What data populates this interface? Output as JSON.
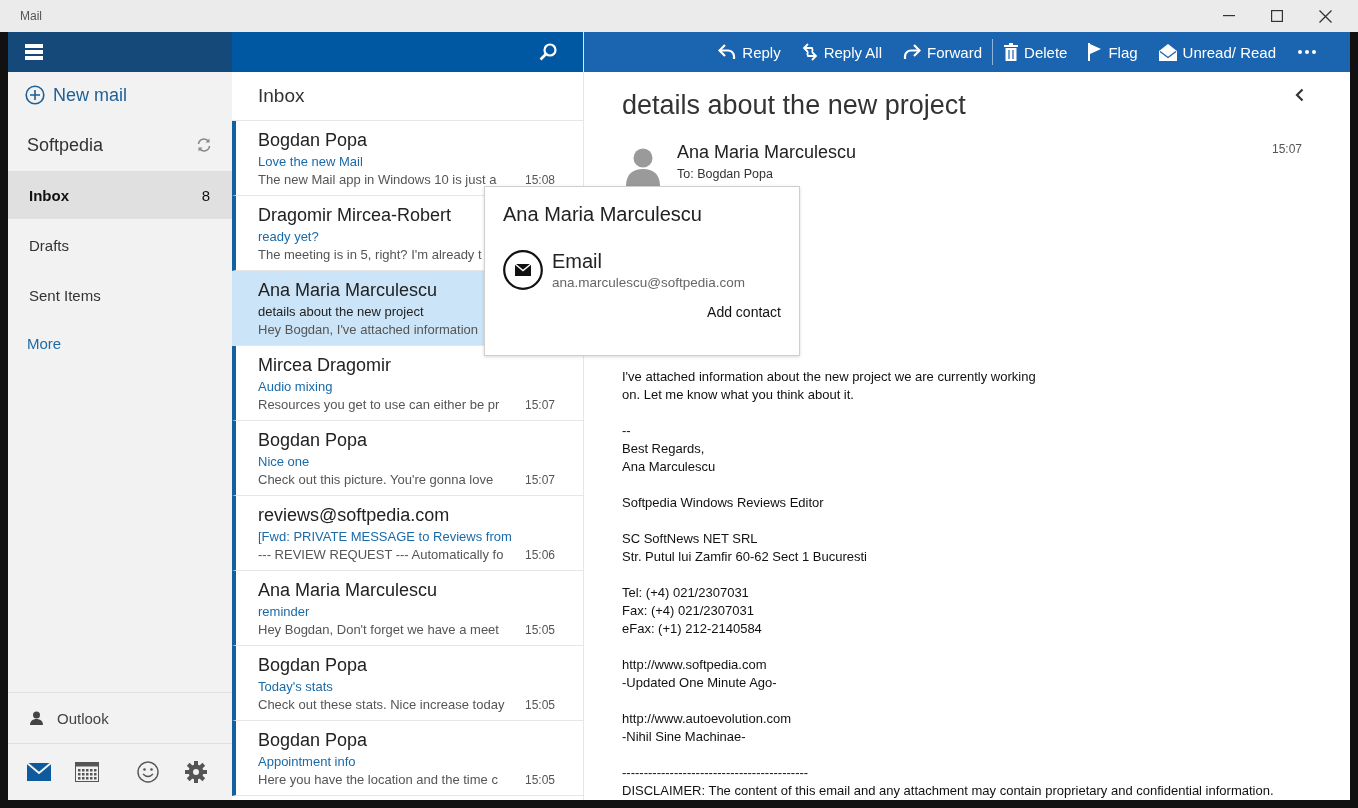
{
  "window": {
    "title": "Mail"
  },
  "sidebar": {
    "new_mail": "New mail",
    "account": "Softpedia",
    "folders": [
      {
        "label": "Inbox",
        "count": "8",
        "selected": true
      },
      {
        "label": "Drafts",
        "selected": false
      },
      {
        "label": "Sent Items",
        "selected": false
      }
    ],
    "more": "More",
    "account_switch": "Outlook"
  },
  "toolbar": {
    "actions": [
      {
        "kind": "reply",
        "label": "Reply"
      },
      {
        "kind": "reply-all",
        "label": "Reply All"
      },
      {
        "kind": "forward",
        "label": "Forward"
      },
      {
        "kind": "delete",
        "label": "Delete"
      },
      {
        "kind": "flag",
        "label": "Flag"
      },
      {
        "kind": "unread",
        "label": "Unread/ Read"
      }
    ]
  },
  "message_list": {
    "title": "Inbox",
    "messages": [
      {
        "sender": "Bogdan Popa",
        "subject": "Love the new Mail",
        "preview": "The new Mail app in Windows 10 is just a",
        "time": "15:08",
        "unread": true,
        "selected": false
      },
      {
        "sender": "Dragomir Mircea-Robert",
        "subject": "ready yet?",
        "preview": "The meeting is in 5, right? I'm already t",
        "unread": true,
        "selected": false
      },
      {
        "sender": "Ana Maria Marculescu",
        "subject": "details about the new project",
        "preview": "Hey Bogdan, I've attached information",
        "unread": false,
        "selected": true
      },
      {
        "sender": "Mircea Dragomir",
        "subject": "Audio mixing",
        "preview": "Resources you get to use can either be pr",
        "time": "15:07",
        "unread": true,
        "selected": false
      },
      {
        "sender": "Bogdan Popa",
        "subject": "Nice one",
        "preview": "Check out this picture. You're gonna love",
        "time": "15:07",
        "unread": true,
        "selected": false
      },
      {
        "sender": "reviews@softpedia.com",
        "subject": "[Fwd: PRIVATE MESSAGE to Reviews from",
        "preview": "--- REVIEW REQUEST --- Automatically fo",
        "time": "15:06",
        "unread": true,
        "selected": false
      },
      {
        "sender": "Ana Maria Marculescu",
        "subject": "reminder",
        "preview": "Hey Bogdan, Don't forget we have a meet",
        "time": "15:05",
        "unread": true,
        "selected": false
      },
      {
        "sender": "Bogdan Popa",
        "subject": "Today's stats",
        "preview": "Check out these stats. Nice increase today",
        "time": "15:05",
        "unread": true,
        "selected": false
      },
      {
        "sender": "Bogdan Popa",
        "subject": "Appointment info",
        "preview": "Here you have the location and the time c",
        "time": "15:05",
        "unread": true,
        "selected": false
      }
    ]
  },
  "reading_pane": {
    "subject": "details about the new project",
    "sender": "Ana Maria Marculescu",
    "to": "To: Bogdan Popa",
    "time": "15:07",
    "body": [
      [
        "I've attached information about the new project we are currently working",
        "on. Let me know what you think about it."
      ],
      [
        "--",
        "Best Regards,",
        "Ana Marculescu"
      ],
      [
        "Softpedia Windows Reviews Editor"
      ],
      [
        "SC SoftNews NET SRL",
        "Str. Putul lui Zamfir 60-62 Sect 1 Bucuresti"
      ],
      [
        "Tel: (+4) 021/2307031",
        "Fax: (+4) 021/2307031",
        "eFax: (+1) 212-2140584"
      ],
      [
        "http://www.softpedia.com",
        "-Updated One Minute Ago-"
      ],
      [
        "http://www.autoevolution.com",
        "-Nihil Sine Machinae-"
      ],
      [
        "-------------------------------------------",
        "DISCLAIMER: The content of this email and any attachment may contain proprietary and confidential information."
      ]
    ]
  },
  "contact_card": {
    "name": "Ana Maria Marculescu",
    "method": "Email",
    "address": "ana.marculescu@softpedia.com",
    "action": "Add contact"
  }
}
